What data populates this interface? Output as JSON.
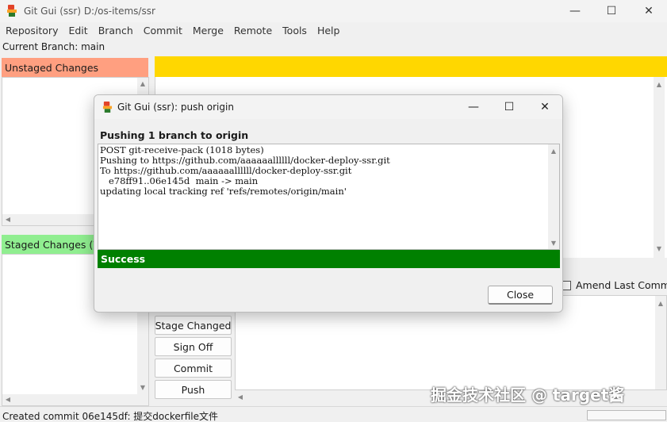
{
  "window": {
    "title": "Git Gui (ssr) D:/os-items/ssr"
  },
  "menu": [
    "Repository",
    "Edit",
    "Branch",
    "Commit",
    "Merge",
    "Remote",
    "Tools",
    "Help"
  ],
  "branch": {
    "label": "Current Branch: main"
  },
  "panels": {
    "unstaged": "Unstaged Changes",
    "staged": "Staged Changes (W"
  },
  "amend": {
    "label": "Amend Last Commit"
  },
  "buttons": {
    "stage_changed": "Stage Changed",
    "sign_off": "Sign Off",
    "commit": "Commit",
    "push": "Push"
  },
  "status": {
    "text": "Created commit 06e145df: 提交dockerfile文件"
  },
  "watermark": {
    "text": "掘金技术社区 @ target酱"
  },
  "dialog": {
    "title": "Git Gui (ssr): push origin",
    "heading": "Pushing 1 branch to origin",
    "log": [
      "POST git-receive-pack (1018 bytes)",
      "Pushing to https://github.com/aaaaaallllll/docker-deploy-ssr.git",
      "To https://github.com/aaaaaallllll/docker-deploy-ssr.git",
      "   e78ff91..06e145d  main -> main",
      "updating local tracking ref 'refs/remotes/origin/main'"
    ],
    "success": "Success",
    "close_label": "Close"
  },
  "colors": {
    "unstaged": "#ff9f80",
    "staged": "#90ee90",
    "diff_header": "#ffd700",
    "success": "#008000"
  }
}
